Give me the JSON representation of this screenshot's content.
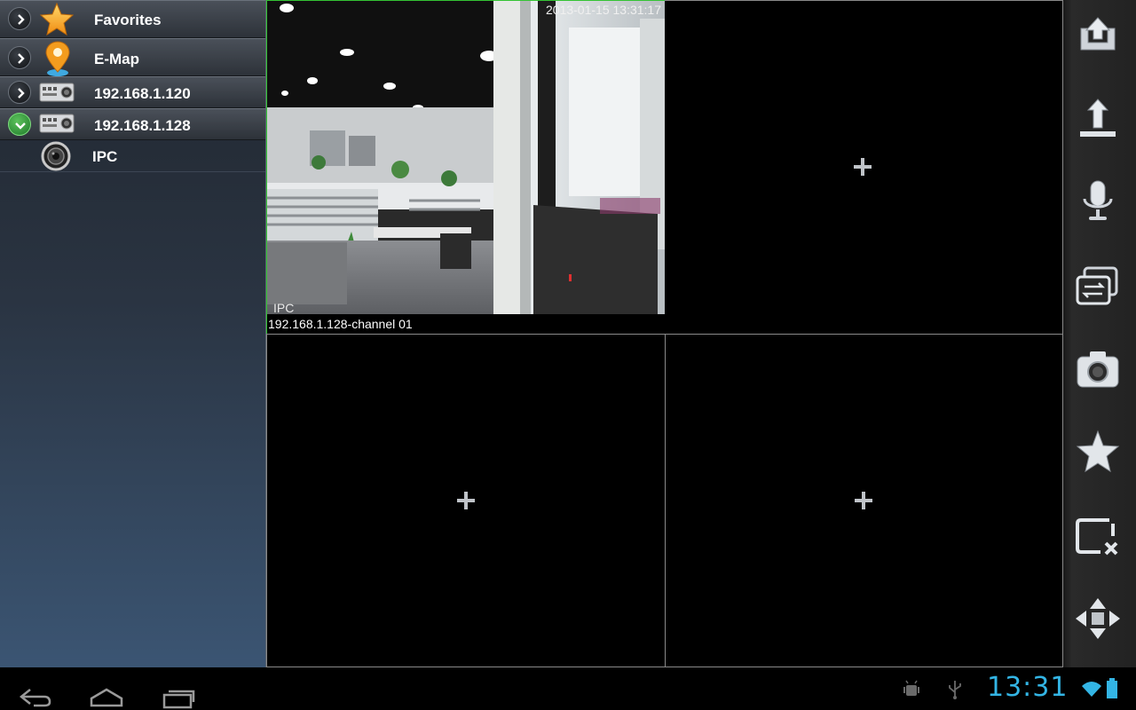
{
  "sidebar": {
    "items": [
      {
        "label": "Favorites",
        "icon": "star-icon",
        "expanded": false
      },
      {
        "label": "E-Map",
        "icon": "map-pin-icon",
        "expanded": false
      },
      {
        "label": "192.168.1.120",
        "icon": "dvr-device-icon",
        "expanded": false
      },
      {
        "label": "192.168.1.128",
        "icon": "dvr-device-icon",
        "expanded": true
      },
      {
        "label": "IPC",
        "icon": "camera-lens-icon",
        "child": true
      }
    ]
  },
  "video": {
    "timestamp": "2013-01-15 13:31:17",
    "osd_label": "IPC",
    "channel_label": "192.168.1.128-channel 01",
    "active_border_color": "#34c334"
  },
  "toolbar": {
    "tools": [
      "upload-icon",
      "push-to-top-icon",
      "microphone-icon",
      "switch-stream-icon",
      "camera-snapshot-icon",
      "favorite-star-icon",
      "close-window-icon",
      "ptz-direction-icon"
    ]
  },
  "statusbar": {
    "clock": "13:31",
    "clock_color": "#33b5e5"
  }
}
